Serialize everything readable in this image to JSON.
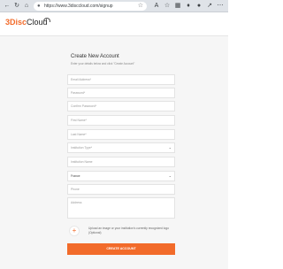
{
  "browser": {
    "url": "https://www.3disccloud.com/signup"
  },
  "brand": {
    "logo_accent": "3Disc",
    "logo_rest": "Cloud",
    "accent_color": "#f26b2a"
  },
  "form": {
    "title": "Create New Account",
    "subtitle": "Enter your details below and click \"Create Account\"",
    "fields": {
      "email": "Email Address*",
      "password": "Password*",
      "confirm_password": "Confirm Password*",
      "first_name": "First Name*",
      "last_name": "Last Name*",
      "institution_type": "Institution Type*",
      "institution_name": "Institution Name",
      "country": "France",
      "phone": "Phone",
      "address": "Address"
    },
    "upload_text": "Upload an image or your institution's currently recognized logo (Optional)",
    "submit_label": "CREATE ACCOUNT"
  }
}
